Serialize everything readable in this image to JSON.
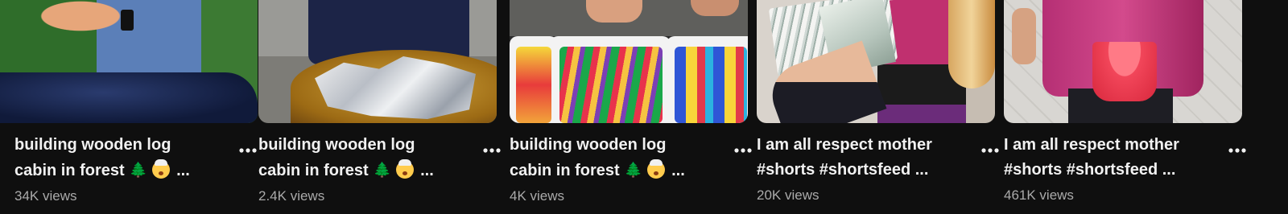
{
  "shorts": [
    {
      "title_line1": "building wooden log",
      "title_line2": "cabin in forest",
      "tree_icon": "tree-icon",
      "face_icon": "exploding-head-icon",
      "ellipsis": "...",
      "views": "34K views"
    },
    {
      "title_line1": "building wooden log",
      "title_line2": "cabin in forest",
      "tree_icon": "tree-icon",
      "face_icon": "exploding-head-icon",
      "ellipsis": "...",
      "views": "2.4K views"
    },
    {
      "title_line1": "building wooden log",
      "title_line2": "cabin in forest",
      "tree_icon": "tree-icon",
      "face_icon": "exploding-head-icon",
      "ellipsis": "...",
      "views": "4K views"
    },
    {
      "title_line1": "I am all respect mother",
      "title_line2": "#shorts #shortsfeed ...",
      "views": "20K views"
    },
    {
      "title_line1": "I am all respect mother",
      "title_line2": "#shorts #shortsfeed ...",
      "views": "461K views"
    }
  ],
  "tree_glyph": "🌲",
  "more_icon": "more-vert-icon",
  "colors": {
    "background": "#0f0f0f",
    "title": "#f1f1f1",
    "views": "#aaaaaa"
  }
}
